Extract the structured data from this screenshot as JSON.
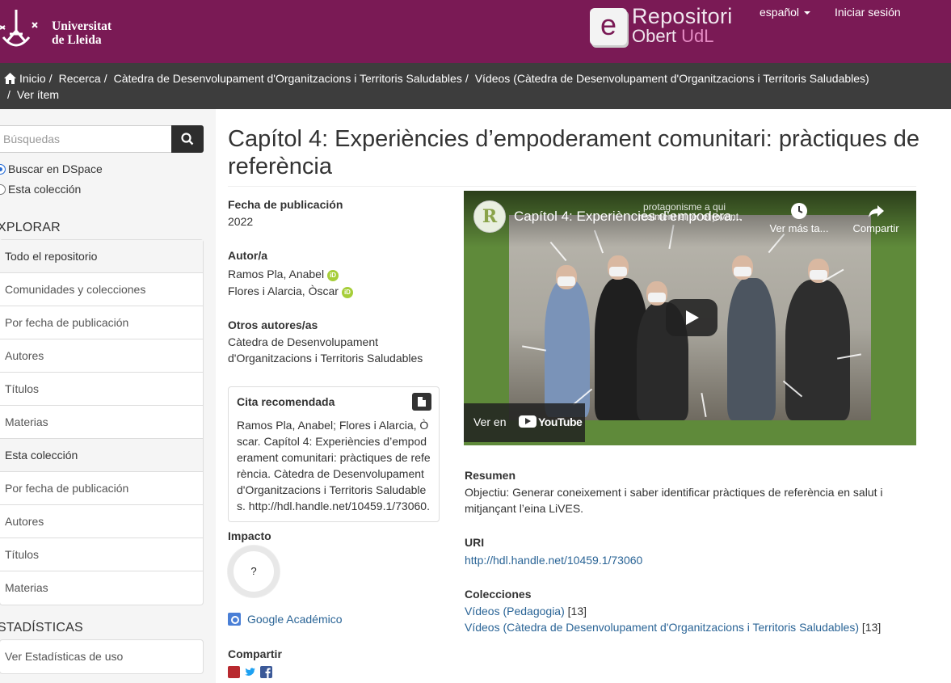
{
  "header": {
    "university_line1": "Universitat",
    "university_line2": "de Lleida",
    "repo_line1": "Repositori",
    "repo_line2a": "Obert ",
    "repo_line2b": "UdL",
    "repo_letter": "e",
    "language": "español",
    "login": "Iniciar sesión"
  },
  "breadcrumb": {
    "items": [
      "Inicio",
      "Recerca",
      "Càtedra de Desenvolupament d'Organitzacions i Territoris Saludables",
      "Vídeos (Càtedra de Desenvolupament d'Organitzacions i Territoris Saludables)",
      "Ver ítem"
    ]
  },
  "sidebar": {
    "search_placeholder": "Búsquedas",
    "radio_all": "Buscar en DSpace",
    "radio_collection": "Esta colección",
    "explore_heading": "XPLORAR",
    "explore_group": [
      "Todo el repositorio",
      "Comunidades y colecciones",
      "Por fecha de publicación",
      "Autores",
      "Títulos",
      "Materias"
    ],
    "collection_group": [
      "Esta colección",
      "Por fecha de publicación",
      "Autores",
      "Títulos",
      "Materias"
    ],
    "stats_heading": "STADÍSTICAS",
    "stats_link": "Ver Estadísticas de uso"
  },
  "item": {
    "title": "Capítol 4: Experiències d’empoderament comunitari: pràctiques de referència",
    "date_label": "Fecha de publicación",
    "date_value": "2022",
    "author_label": "Autor/a",
    "authors": [
      "Ramos Pla, Anabel",
      "Flores i Alarcia, Òscar"
    ],
    "orcid_text": "iD",
    "other_authors_label": "Otros autores/as",
    "other_authors_line1": "Càtedra de Desenvolupament",
    "other_authors_line2": "d'Organitzacions i Territoris Saludables",
    "cite_label": "Cita recomendada",
    "cite_text": "Ramos Pla, Anabel; Flores i Alarcia, Òscar. Capítol 4: Experiències d’empoderament comunitari: pràctiques de referència. Càtedra de Desenvolupament d'Organitzacions i Territoris Saludables. http://hdl.handle.net/10459.1/73060.",
    "impact_label": "Impacto",
    "impact_badge": "?",
    "scholar_link": "Google Académico",
    "share_label": "Compartir",
    "abstract_label": "Resumen",
    "abstract_line1": "Objectiu: Generar coneixement i saber identificar pràctiques de referència en salut i",
    "abstract_line2": "mitjançant l’eina LiVES.",
    "uri_label": "URI",
    "uri_value": "http://hdl.handle.net/10459.1/73060",
    "collections_label": "Colecciones",
    "collections": [
      {
        "name": "Vídeos (Pedagogia)",
        "count": "[13]"
      },
      {
        "name": "Vídeos (Càtedra de Desenvolupament d'Organitzacions i Territoris Saludables)",
        "count": "[13]"
      }
    ]
  },
  "video": {
    "channel_letter": "R",
    "title": "Capítol 4: Experiències d’empodera...",
    "overlay_line1": "protagonisme a qui",
    "overlay_line2": "realment el té: el jovent.",
    "watch_later": "Ver más ta...",
    "share": "Compartir",
    "watch_on": "Ver en",
    "youtube": "YouTube"
  },
  "colors": {
    "header_bg": "#7a1a55",
    "breadcrumb_bg": "#3d3d3d",
    "link": "#2a6496",
    "orcid": "#a6ce39"
  }
}
